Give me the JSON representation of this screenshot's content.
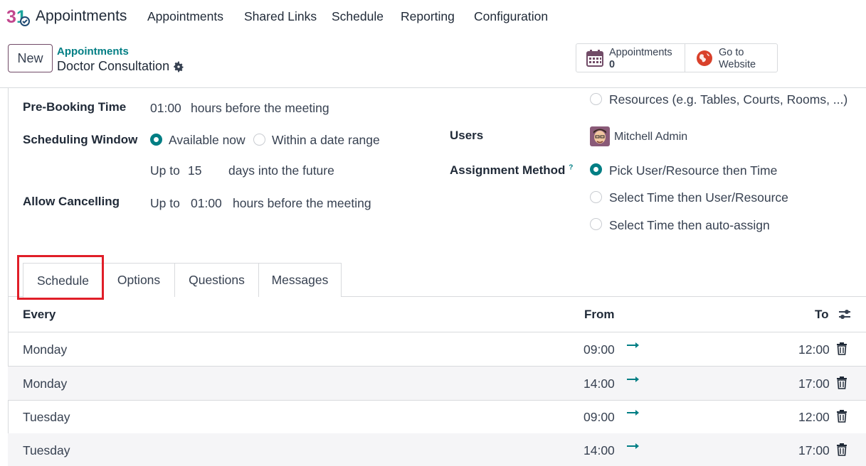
{
  "navbar": {
    "app_name": "Appointments",
    "items": [
      "Appointments",
      "Shared Links",
      "Schedule",
      "Reporting",
      "Configuration"
    ]
  },
  "control": {
    "new_label": "New",
    "breadcrumb": "Appointments",
    "record_title": "Doctor Consultation",
    "smart_buttons": {
      "appointments_label": "Appointments",
      "appointments_count": "0",
      "website_label_1": "Go to",
      "website_label_2": "Website"
    }
  },
  "form": {
    "prebooking": {
      "label": "Pre-Booking Time",
      "value": "01:00",
      "suffix": "hours before the meeting"
    },
    "window": {
      "label": "Scheduling Window",
      "option_now": "Available now",
      "option_range": "Within a date range",
      "upto": "Up to",
      "days": "15",
      "days_suffix": "days into the future"
    },
    "cancel": {
      "label": "Allow Cancelling",
      "upto": "Up to",
      "value": "01:00",
      "suffix": "hours before the meeting"
    },
    "resources_option": "Resources (e.g. Tables, Courts, Rooms, ...)",
    "users": {
      "label": "Users",
      "value": "Mitchell Admin"
    },
    "assignment": {
      "label": "Assignment Method",
      "help": "?",
      "options": [
        "Pick User/Resource then Time",
        "Select Time then User/Resource",
        "Select Time then auto-assign"
      ]
    }
  },
  "tabs": [
    "Schedule",
    "Options",
    "Questions",
    "Messages"
  ],
  "table": {
    "headers": {
      "every": "Every",
      "from": "From",
      "to": "To"
    },
    "rows": [
      {
        "day": "Monday",
        "from": "09:00",
        "to": "12:00"
      },
      {
        "day": "Monday",
        "from": "14:00",
        "to": "17:00"
      },
      {
        "day": "Tuesday",
        "from": "09:00",
        "to": "12:00"
      },
      {
        "day": "Tuesday",
        "from": "14:00",
        "to": "17:00"
      }
    ]
  },
  "colors": {
    "accent": "#017e84",
    "brand": "#714b67",
    "highlight": "#e01e28"
  }
}
